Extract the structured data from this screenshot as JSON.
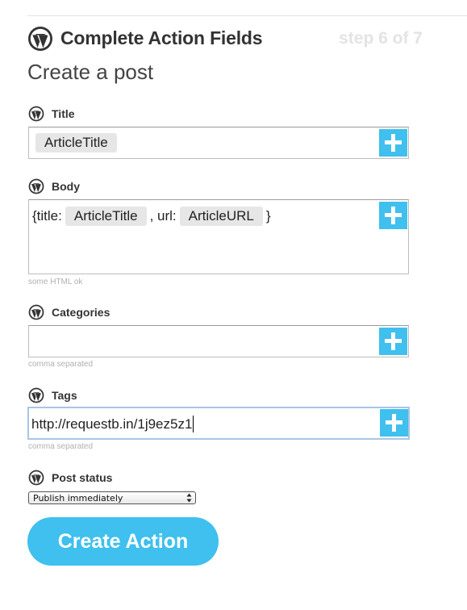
{
  "header": {
    "title": "Complete Action Fields",
    "step": "step 6 of 7",
    "subtitle": "Create a post"
  },
  "icons": {
    "wordpress": "wordpress-logo-icon",
    "add": "plus-icon"
  },
  "colors": {
    "accent": "#3fc0ee",
    "token_bg": "#e6e6e6",
    "step_text": "#e3e3e3",
    "focus_border": "#a8c6e6"
  },
  "fields": {
    "title": {
      "label": "Title",
      "token": "ArticleTitle"
    },
    "body": {
      "label": "Body",
      "prefix": "{title:",
      "token1": "ArticleTitle",
      "middle": ", url:",
      "token2": "ArticleURL",
      "suffix": "}",
      "hint": "some HTML ok"
    },
    "categories": {
      "label": "Categories",
      "value": "",
      "hint": "comma separated"
    },
    "tags": {
      "label": "Tags",
      "value": "http://requestb.in/1j9ez5z1",
      "hint": "comma separated"
    },
    "post_status": {
      "label": "Post status",
      "selected": "Publish immediately"
    }
  },
  "actions": {
    "create_label": "Create Action"
  }
}
